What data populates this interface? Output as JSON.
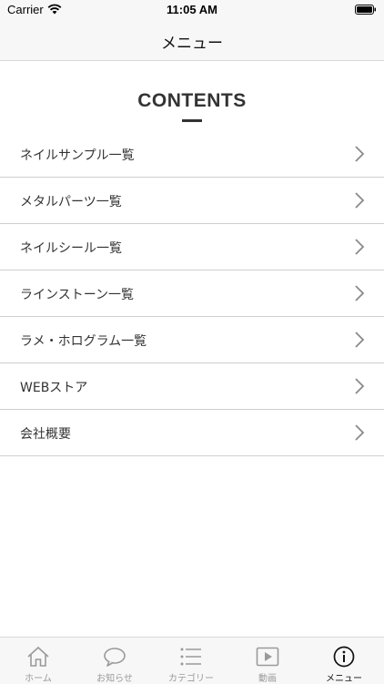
{
  "status_bar": {
    "carrier": "Carrier",
    "time": "11:05 AM"
  },
  "nav": {
    "title": "メニュー"
  },
  "section": {
    "heading": "CONTENTS"
  },
  "menu": {
    "items": [
      {
        "label": "ネイルサンプル一覧"
      },
      {
        "label": "メタルパーツ一覧"
      },
      {
        "label": "ネイルシール一覧"
      },
      {
        "label": "ラインストーン一覧"
      },
      {
        "label": "ラメ・ホログラム一覧"
      },
      {
        "label": "WEBストア"
      },
      {
        "label": "会社概要"
      }
    ]
  },
  "tab_bar": {
    "tabs": [
      {
        "label": "ホーム",
        "icon": "home-icon",
        "active": false
      },
      {
        "label": "お知らせ",
        "icon": "chat-bubble-icon",
        "active": false
      },
      {
        "label": "カテゴリー",
        "icon": "list-icon",
        "active": false
      },
      {
        "label": "動画",
        "icon": "play-icon",
        "active": false
      },
      {
        "label": "メニュー",
        "icon": "info-icon",
        "active": true
      }
    ]
  },
  "colors": {
    "active_tab": "#111111",
    "inactive_tab": "#9a9a9a",
    "separator": "#cfcfcf"
  }
}
